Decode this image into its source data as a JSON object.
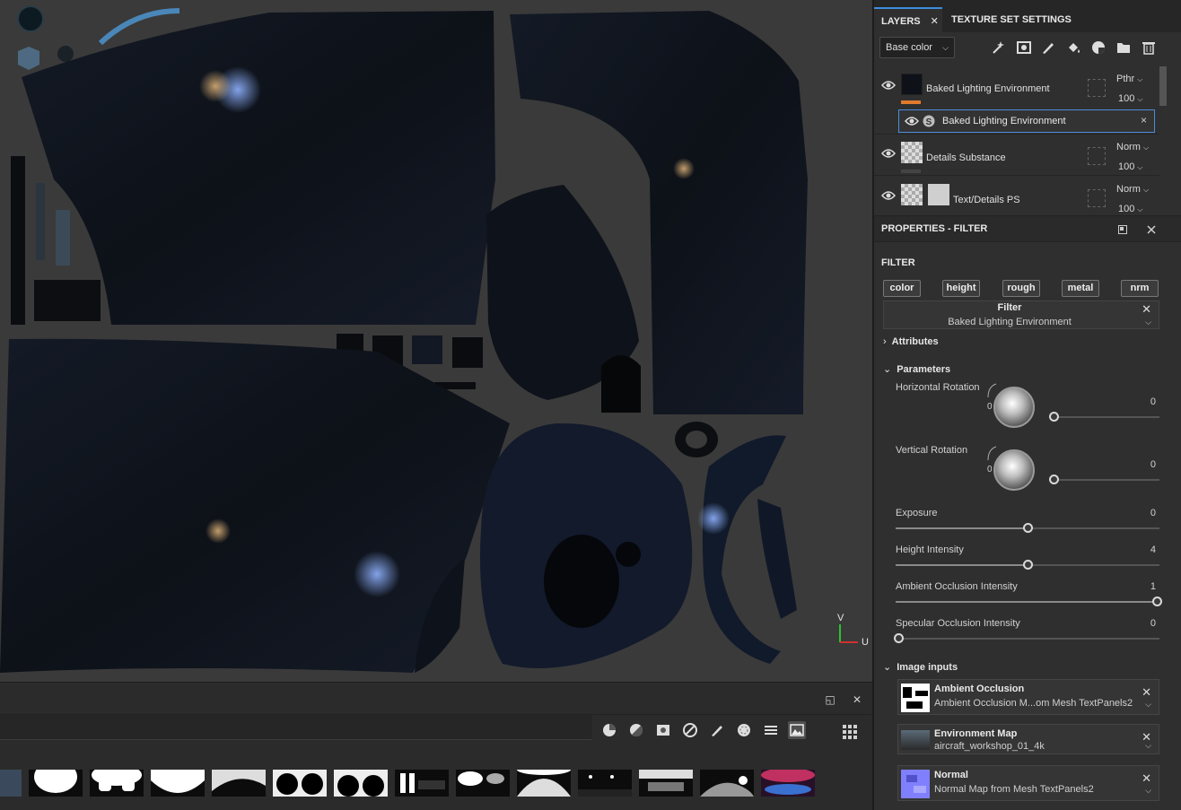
{
  "viewport": {
    "axes": {
      "v": "V",
      "u": "U"
    }
  },
  "shelf": {
    "controls": {
      "maximize": "◱",
      "close": "✕"
    },
    "filters": [
      "all-icon",
      "half-icon",
      "square-icon",
      "contrast-icon",
      "brush-icon",
      "sphere-icon",
      "grid-icon",
      "image-icon"
    ],
    "thumbnail_count": 14
  },
  "layers_tab": {
    "tabs": [
      {
        "label": "LAYERS",
        "close": "✕"
      },
      {
        "label": "TEXTURE SET SETTINGS"
      }
    ],
    "channel_select": "Base color",
    "layers": [
      {
        "name": "Baked Lighting Environment",
        "blend": "Pthr",
        "opacity": "100",
        "color": "#e07b2d",
        "thumb": "dark"
      },
      {
        "name": "Details Substance",
        "blend": "Norm",
        "opacity": "100",
        "color": "#444444",
        "thumb": "checker"
      },
      {
        "name": "Text/Details PS",
        "blend": "Norm",
        "opacity": "100",
        "color": "#e07b2d",
        "thumb": "checker"
      }
    ],
    "effect": {
      "name": "Baked Lighting Environment",
      "close": "×"
    }
  },
  "properties": {
    "title": "PROPERTIES - FILTER",
    "section": "FILTER",
    "channels": [
      "color",
      "height",
      "rough",
      "metal",
      "nrm"
    ],
    "filter_box": {
      "title": "Filter",
      "value": "Baked Lighting Environment"
    },
    "attributes_label": "Attributes",
    "parameters_label": "Parameters",
    "params": [
      {
        "label": "Horizontal Rotation",
        "value": "0",
        "type": "dial",
        "dial_value": "0",
        "fraction": 0.0
      },
      {
        "label": "Vertical Rotation",
        "value": "0",
        "type": "dial",
        "dial_value": "0",
        "fraction": 0.0
      },
      {
        "label": "Exposure",
        "value": "0",
        "type": "slider",
        "fraction": 0.5
      },
      {
        "label": "Height Intensity",
        "value": "4",
        "type": "slider",
        "fraction": 0.5
      },
      {
        "label": "Ambient Occlusion Intensity",
        "value": "1",
        "type": "slider",
        "fraction": 1.0
      },
      {
        "label": "Specular Occlusion Intensity",
        "value": "0",
        "type": "slider",
        "fraction": 0.0
      }
    ],
    "image_inputs_label": "Image inputs",
    "image_inputs": [
      {
        "title": "Ambient Occlusion",
        "value": "Ambient Occlusion M...om Mesh TextPanels2"
      },
      {
        "title": "Environment Map",
        "value": "aircraft_workshop_01_4k"
      },
      {
        "title": "Normal",
        "value": "Normal Map from Mesh TextPanels2"
      }
    ]
  }
}
